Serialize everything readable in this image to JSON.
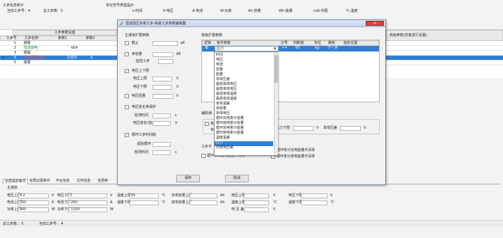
{
  "top": {
    "title": "工步信息统计",
    "cur_step": "当前工步号：4",
    "total_steps": "总工步数：5",
    "hint_title": "单位符号类型提示",
    "units": [
      "s-时间",
      "V-电压",
      "A-电流",
      "W-功率",
      "Ah-容量",
      "Wh-能量",
      "mΩ-内阻",
      "℃-温度"
    ]
  },
  "step_table": {
    "group_header": "工步参数设置",
    "cols": [
      "工步号",
      "工步名称",
      "参数1",
      "参数2"
    ],
    "rows": [
      {
        "no": "1",
        "name": "搁置",
        "p1": "",
        "p2": ""
      },
      {
        "no": "2",
        "name": "恒流放电",
        "p1": "60A",
        "p2": ""
      },
      {
        "no": "3",
        "name": "搁置",
        "p1": "",
        "p2": ""
      },
      {
        "no": "4",
        "name": "恒功恒压充电",
        "p1": "3.65V",
        "p2": "6"
      },
      {
        "no": "5",
        "name": "搁置",
        "p1": "",
        "p2": ""
      }
    ],
    "right_header": "高级参数(仿真进行设置)"
  },
  "dialog": {
    "title": "恒流恒压充电工步-高级工步参数编辑器",
    "left_title": "主通道扩展参数",
    "opt_jump": "截止",
    "unit_jump": "aE",
    "opt_cap": "净容量",
    "unit_cap": "AE",
    "lbl_lock": "监控工步",
    "opt_vlimit": "电压上下限",
    "lbl_vup": "电压上限",
    "unit_vup": "V",
    "lbl_vdown": "电压下限",
    "unit_vdown": "V",
    "opt_tlimit": "电压恒量",
    "unit_tlimit": "V",
    "opt_vchange": "电压变化率保护",
    "lbl_detect": "检测时间",
    "unit_detect": "s",
    "lbl_vchg": "电压变化(值)",
    "unit_vchg": "V",
    "opt_loop": "循环工步时间能",
    "lbl_loopstart": "起始循环",
    "lbl_looptime": "检测时间",
    "unit_looptime": "s",
    "right_title": "高级扩展参数",
    "cond_cols": [
      "逻辑",
      "条件参数",
      "分号",
      "判断值",
      "单位",
      "跳转",
      "指定位置"
    ],
    "cond_row": {
      "logic": "或",
      "param": "压力",
      "op": ">=",
      "value": "85",
      "unit": "Kg",
      "jump": "下一步"
    },
    "dropdown_items": [
      "时间",
      "电压",
      "电流",
      "容量",
      "能量",
      "单体压差",
      "最低单体电压",
      "最高单体电压",
      "最低单体温度",
      "最高单体温度",
      "单体温差",
      "净容量",
      "单体电压",
      "循环充电累计容量",
      "循环放电累计容量",
      "循环充电累计能量",
      "循环放电累计能量",
      "温度温差",
      "压力",
      "外部电压差"
    ],
    "selected_index": 18,
    "aux_title": "辅助通",
    "aux_label1": "单体",
    "aux_label2": "单",
    "pressure_lower": "压力下限",
    "pressure_unit": "V",
    "single_diff": "单体压差",
    "single_diff_unit": "V",
    "step_param": "工步平",
    "chk_loop_energy_left": "循环累计放电能量不清零",
    "chk_loop_energy_right1": "循环累计充电能量不清零",
    "chk_loop_energy_right2": "循环累计放电能量不清零",
    "btn_save": "保存",
    "btn_cancel": "取消",
    "scroll_thumb": "下"
  },
  "bottom": {
    "tabs": [
      "全局保护条件",
      "全局记录条件",
      "平台信息",
      "文件信息",
      "全局参"
    ],
    "section": "主通道",
    "fields": [
      {
        "label": "电压上限",
        "value": "4.2",
        "unit": "V"
      },
      {
        "label": "电流上限",
        "value": "200",
        "unit": "A"
      },
      {
        "label": "功率上限",
        "value": "900",
        "unit": "W"
      },
      {
        "label": "电压下限",
        "value": "3",
        "unit": "V"
      },
      {
        "label": "电流下限",
        "value": "-260",
        "unit": "A"
      },
      {
        "label": "功率下限",
        "value": "-1100",
        "unit": "W"
      },
      {
        "label": "温度上限",
        "value": "65",
        "unit": "℃"
      },
      {
        "label": "温度下限",
        "value": "",
        "unit": "℃"
      },
      {
        "label": "充电容量上限",
        "value": "",
        "unit": "Ah"
      },
      {
        "label": "放电容量上限",
        "value": "",
        "unit": "Ah"
      },
      {
        "label": "电压上限",
        "value": "",
        "unit": "V"
      },
      {
        "label": "温度上限",
        "value": "",
        "unit": "℃"
      },
      {
        "label": "电 压 差",
        "value": "",
        "unit": "V"
      },
      {
        "label": "电压下限",
        "value": "",
        "unit": "V"
      },
      {
        "label": "温度下限",
        "value": "",
        "unit": "℃"
      }
    ]
  },
  "status": {
    "total": "总工步数： 5",
    "current": "当前工步号： 4"
  }
}
